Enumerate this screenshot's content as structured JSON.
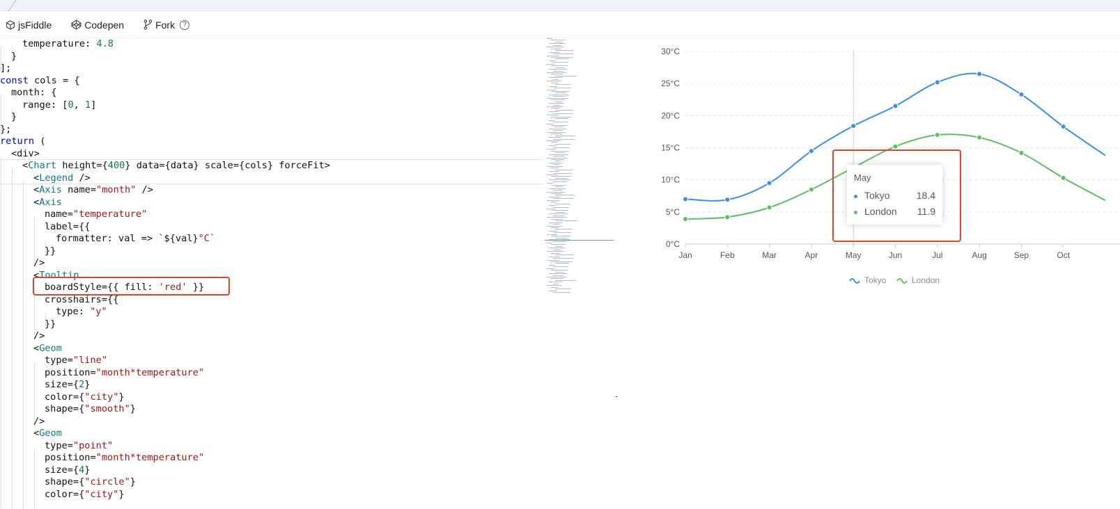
{
  "toolbar": {
    "jsfiddle_label": "jsFiddle",
    "codepen_label": "Codepen",
    "fork_label": "Fork",
    "help_glyph": "?"
  },
  "code_lines": [
    [
      [
        4,
        ""
      ],
      [
        "plain",
        "temperature: "
      ],
      [
        "num",
        "4.8"
      ]
    ],
    [
      [
        2,
        ""
      ],
      [
        "plain",
        "}"
      ]
    ],
    [
      [
        0,
        ""
      ],
      [
        "plain",
        "];"
      ]
    ],
    [
      [
        0,
        ""
      ],
      [
        "kw",
        "const"
      ],
      [
        "plain",
        " cols = {"
      ]
    ],
    [
      [
        2,
        ""
      ],
      [
        "plain",
        "month: {"
      ]
    ],
    [
      [
        4,
        ""
      ],
      [
        "plain",
        "range: ["
      ],
      [
        "num",
        "0"
      ],
      [
        "plain",
        ", "
      ],
      [
        "num",
        "1"
      ],
      [
        "plain",
        "]"
      ]
    ],
    [
      [
        2,
        ""
      ],
      [
        "plain",
        "}"
      ]
    ],
    [
      [
        0,
        ""
      ],
      [
        "plain",
        "};"
      ]
    ],
    [
      [
        0,
        ""
      ],
      [
        "kw",
        "return"
      ],
      [
        "plain",
        " ("
      ]
    ],
    [
      [
        2,
        ""
      ],
      [
        "plain",
        "<div>"
      ]
    ],
    [
      [
        4,
        ""
      ],
      [
        "plain",
        "<"
      ],
      [
        "tag",
        "Chart"
      ],
      [
        "plain",
        " height={"
      ],
      [
        "num",
        "400"
      ],
      [
        "plain",
        "} data={data} scale={cols} forceFit>"
      ]
    ],
    [
      [
        6,
        ""
      ],
      [
        "plain",
        "<"
      ],
      [
        "tag",
        "Legend"
      ],
      [
        "plain",
        " />"
      ]
    ],
    [
      [
        6,
        ""
      ],
      [
        "plain",
        "<"
      ],
      [
        "tag",
        "Axis"
      ],
      [
        "plain",
        " name="
      ],
      [
        "str",
        "\"month\""
      ],
      [
        "plain",
        " />"
      ]
    ],
    [
      [
        6,
        ""
      ],
      [
        "plain",
        "<"
      ],
      [
        "tag",
        "Axis"
      ]
    ],
    [
      [
        8,
        ""
      ],
      [
        "plain",
        "name="
      ],
      [
        "str",
        "\"temperature\""
      ]
    ],
    [
      [
        8,
        ""
      ],
      [
        "plain",
        "label={{"
      ]
    ],
    [
      [
        10,
        ""
      ],
      [
        "plain",
        "formatter: val => "
      ],
      [
        "str",
        "`"
      ],
      [
        "plain",
        "${val}"
      ],
      [
        "str",
        "°C`"
      ]
    ],
    [
      [
        8,
        ""
      ],
      [
        "plain",
        "}}"
      ]
    ],
    [
      [
        6,
        ""
      ],
      [
        "plain",
        "/>"
      ]
    ],
    [
      [
        6,
        ""
      ],
      [
        "plain",
        "<"
      ],
      [
        "tag",
        "Tooltip"
      ]
    ],
    [
      [
        8,
        ""
      ],
      [
        "plain",
        "boardStyle={{ fill: "
      ],
      [
        "str",
        "'red'"
      ],
      [
        "plain",
        " }}"
      ]
    ],
    [
      [
        8,
        ""
      ],
      [
        "plain",
        "crosshairs={{"
      ]
    ],
    [
      [
        10,
        ""
      ],
      [
        "plain",
        "type: "
      ],
      [
        "str",
        "\"y\""
      ]
    ],
    [
      [
        8,
        ""
      ],
      [
        "plain",
        "}}"
      ]
    ],
    [
      [
        6,
        ""
      ],
      [
        "plain",
        "/>"
      ]
    ],
    [
      [
        6,
        ""
      ],
      [
        "plain",
        "<"
      ],
      [
        "tag",
        "Geom"
      ]
    ],
    [
      [
        8,
        ""
      ],
      [
        "plain",
        "type="
      ],
      [
        "str",
        "\"line\""
      ]
    ],
    [
      [
        8,
        ""
      ],
      [
        "plain",
        "position="
      ],
      [
        "str",
        "\"month*temperature\""
      ]
    ],
    [
      [
        8,
        ""
      ],
      [
        "plain",
        "size={"
      ],
      [
        "num",
        "2"
      ],
      [
        "plain",
        "}"
      ]
    ],
    [
      [
        8,
        ""
      ],
      [
        "plain",
        "color={"
      ],
      [
        "str",
        "\"city\""
      ],
      [
        "plain",
        "}"
      ]
    ],
    [
      [
        8,
        ""
      ],
      [
        "plain",
        "shape={"
      ],
      [
        "str",
        "\"smooth\""
      ],
      [
        "plain",
        "}"
      ]
    ],
    [
      [
        6,
        ""
      ],
      [
        "plain",
        "/>"
      ]
    ],
    [
      [
        6,
        ""
      ],
      [
        "plain",
        "<"
      ],
      [
        "tag",
        "Geom"
      ]
    ],
    [
      [
        8,
        ""
      ],
      [
        "plain",
        "type="
      ],
      [
        "str",
        "\"point\""
      ]
    ],
    [
      [
        8,
        ""
      ],
      [
        "plain",
        "position="
      ],
      [
        "str",
        "\"month*temperature\""
      ]
    ],
    [
      [
        8,
        ""
      ],
      [
        "plain",
        "size={"
      ],
      [
        "num",
        "4"
      ],
      [
        "plain",
        "}"
      ]
    ],
    [
      [
        8,
        ""
      ],
      [
        "plain",
        "shape={"
      ],
      [
        "str",
        "\"circle\""
      ],
      [
        "plain",
        "}"
      ]
    ],
    [
      [
        8,
        ""
      ],
      [
        "plain",
        "color={"
      ],
      [
        "str",
        "\"city\""
      ],
      [
        "plain",
        "}"
      ]
    ]
  ],
  "colors": {
    "tokyo": "#3b8fe8",
    "london": "#5cbf63",
    "highlight": "#e0432f",
    "keyword": "#0000d8",
    "number": "#0a7a3e",
    "string": "#a31515",
    "tag": "#107a7a"
  },
  "chart_data": {
    "type": "line",
    "categories": [
      "Jan",
      "Feb",
      "Mar",
      "Apr",
      "May",
      "Jun",
      "Jul",
      "Aug",
      "Sep",
      "Oct"
    ],
    "series": [
      {
        "name": "Tokyo",
        "values": [
          7.0,
          6.9,
          9.5,
          14.5,
          18.4,
          21.5,
          25.2,
          26.5,
          23.3,
          18.3
        ]
      },
      {
        "name": "London",
        "values": [
          3.9,
          4.2,
          5.7,
          8.5,
          11.9,
          15.2,
          17.0,
          16.6,
          14.2,
          10.3
        ]
      }
    ],
    "yticks": [
      "0°C",
      "5°C",
      "10°C",
      "15°C",
      "20°C",
      "25°C",
      "30°C"
    ],
    "ylim": [
      0,
      30
    ],
    "smooth": true,
    "grid": "horizontal dashed",
    "legend": "bottom-center",
    "crosshair_category": "May",
    "tooltip": {
      "title": "May",
      "items": [
        {
          "name": "Tokyo",
          "value": "18.4"
        },
        {
          "name": "London",
          "value": "11.9"
        }
      ]
    }
  }
}
